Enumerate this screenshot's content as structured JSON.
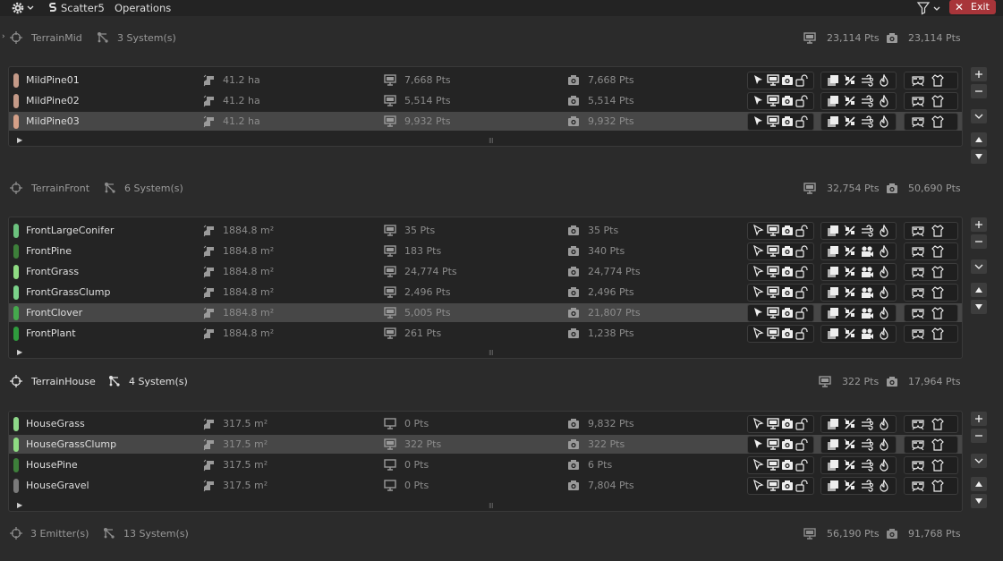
{
  "topbar": {
    "app_name": "Scatter5",
    "menu": "Operations",
    "exit_label": "Exit"
  },
  "groups": [
    {
      "emitter": "TerrainMid",
      "systems": "3 System(s)",
      "screen_pts": "23,114 Pts",
      "render_pts": "23,114 Pts",
      "active": false,
      "rows": [
        {
          "name": "MildPine01",
          "color": "#c49a88",
          "area": "41.2 ha",
          "screen_pts": "7,668 Pts",
          "render_pts": "7,668 Pts",
          "selected": false,
          "anim": false
        },
        {
          "name": "MildPine02",
          "color": "#c49a88",
          "area": "41.2 ha",
          "screen_pts": "5,514 Pts",
          "render_pts": "5,514 Pts",
          "selected": false,
          "anim": false
        },
        {
          "name": "MildPine03",
          "color": "#d4a088",
          "area": "41.2 ha",
          "screen_pts": "9,932 Pts",
          "render_pts": "9,932 Pts",
          "selected": true,
          "anim": false
        }
      ]
    },
    {
      "emitter": "TerrainFront",
      "systems": "6 System(s)",
      "screen_pts": "32,754 Pts",
      "render_pts": "50,690 Pts",
      "active": false,
      "rows": [
        {
          "name": "FrontLargeConifer",
          "color": "#6cc27e",
          "area": "1884.8 m²",
          "screen_pts": "35 Pts",
          "render_pts": "35 Pts",
          "selected": false,
          "anim": false
        },
        {
          "name": "FrontPine",
          "color": "#3d7f3a",
          "area": "1884.8 m²",
          "screen_pts": "183 Pts",
          "render_pts": "340 Pts",
          "selected": false,
          "anim": true
        },
        {
          "name": "FrontGrass",
          "color": "#8fdc83",
          "area": "1884.8 m²",
          "screen_pts": "24,774 Pts",
          "render_pts": "24,774 Pts",
          "selected": false,
          "anim": true
        },
        {
          "name": "FrontGrassClump",
          "color": "#7bd28a",
          "area": "1884.8 m²",
          "screen_pts": "2,496 Pts",
          "render_pts": "2,496 Pts",
          "selected": false,
          "anim": true
        },
        {
          "name": "FrontClover",
          "color": "#45a94d",
          "area": "1884.8 m²",
          "screen_pts": "5,005 Pts",
          "render_pts": "21,807 Pts",
          "selected": true,
          "anim": true
        },
        {
          "name": "FrontPlant",
          "color": "#2f9b3d",
          "area": "1884.8 m²",
          "screen_pts": "261 Pts",
          "render_pts": "1,238 Pts",
          "selected": false,
          "anim": true
        }
      ]
    },
    {
      "emitter": "TerrainHouse",
      "systems": "4 System(s)",
      "screen_pts": "322 Pts",
      "render_pts": "17,964 Pts",
      "active": true,
      "rows": [
        {
          "name": "HouseGrass",
          "color": "#8ed889",
          "area": "317.5 m²",
          "screen_pts": "0 Pts",
          "render_pts": "9,832 Pts",
          "selected": false,
          "anim": false
        },
        {
          "name": "HouseGrassClump",
          "color": "#8fdc83",
          "area": "317.5 m²",
          "screen_pts": "322 Pts",
          "render_pts": "322 Pts",
          "selected": true,
          "anim": false
        },
        {
          "name": "HousePine",
          "color": "#3d7f3a",
          "area": "317.5 m²",
          "screen_pts": "0 Pts",
          "render_pts": "6 Pts",
          "selected": false,
          "anim": false
        },
        {
          "name": "HouseGravel",
          "color": "#7a7a7a",
          "area": "317.5 m²",
          "screen_pts": "0 Pts",
          "render_pts": "7,804 Pts",
          "selected": false,
          "anim": false
        }
      ]
    }
  ],
  "footer": {
    "emitters": "3 Emitter(s)",
    "systems": "13 System(s)",
    "screen_pts": "56,190 Pts",
    "render_pts": "91,768 Pts"
  },
  "icons": {
    "emitter": "crosshair-icon",
    "systems": "nodes-icon",
    "area": "area-icon",
    "screen": "monitor-icon",
    "render": "camera-icon"
  }
}
